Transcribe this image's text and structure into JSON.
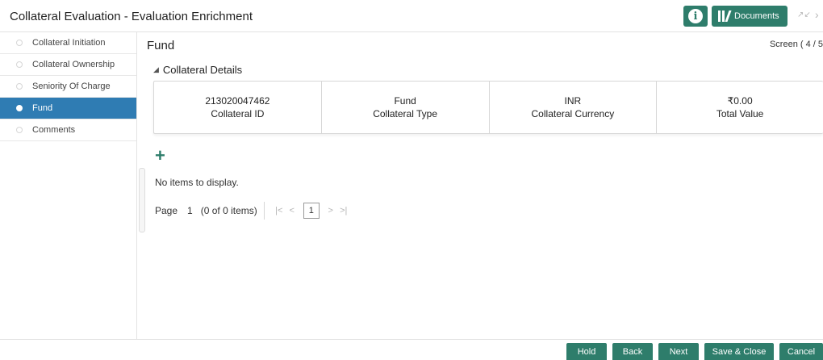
{
  "header": {
    "title": "Collateral Evaluation - Evaluation Enrichment",
    "documents_label": "Documents"
  },
  "icons": {
    "info": "info-icon",
    "documents": "documents-icon",
    "shrink": "shrink-icon",
    "more": "chevron-right-icon",
    "add": "plus-icon",
    "section": "triangle-down-icon"
  },
  "colors": {
    "accent": "#2e7d6b",
    "active_nav": "#2f7cb3"
  },
  "sidebar": {
    "items": [
      {
        "label": "Collateral Initiation",
        "active": false
      },
      {
        "label": "Collateral Ownership",
        "active": false
      },
      {
        "label": "Seniority Of Charge",
        "active": false
      },
      {
        "label": "Fund",
        "active": true
      },
      {
        "label": "Comments",
        "active": false
      }
    ]
  },
  "main": {
    "title": "Fund",
    "screen_indicator": "Screen ( 4 / 5",
    "section_title": "Collateral Details",
    "details": [
      {
        "value": "213020047462",
        "label": "Collateral ID"
      },
      {
        "value": "Fund",
        "label": "Collateral Type"
      },
      {
        "value": "INR",
        "label": "Collateral Currency"
      },
      {
        "value": "₹0.00",
        "label": "Total Value"
      }
    ],
    "empty_message": "No items to display.",
    "pager": {
      "page_label": "Page",
      "page_number": "1",
      "count": "(0 of 0 items)",
      "current": "1"
    }
  },
  "footer": {
    "hold": "Hold",
    "back": "Back",
    "next": "Next",
    "save_close": "Save & Close",
    "cancel": "Cancel"
  }
}
